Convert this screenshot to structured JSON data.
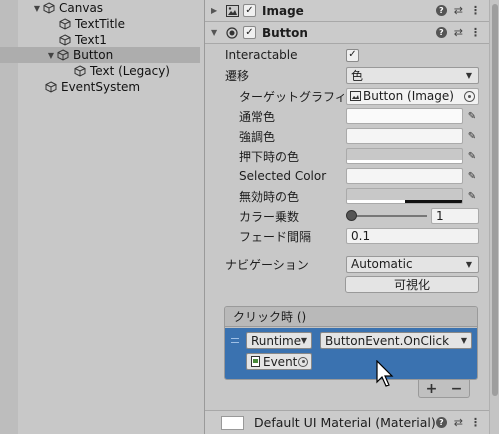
{
  "hierarchy": {
    "items": [
      {
        "label": "Canvas",
        "expanded": true
      },
      {
        "label": "TextTitle"
      },
      {
        "label": "Text1"
      },
      {
        "label": "Button",
        "expanded": true,
        "selected": true
      },
      {
        "label": "Text (Legacy)"
      },
      {
        "label": "EventSystem"
      }
    ]
  },
  "inspector": {
    "image_component": {
      "name": "Image",
      "enabled": true
    },
    "button_component": {
      "name": "Button",
      "enabled": true
    },
    "props": {
      "interactable_label": "Interactable",
      "interactable_value": true,
      "transition_label": "遷移",
      "transition_value": "色",
      "target_graphic_label": "ターゲットグラフィックス",
      "target_graphic_value": "Button (Image)",
      "normal_color_label": "通常色",
      "highlight_color_label": "強調色",
      "pressed_color_label": "押下時の色",
      "selected_color_label": "Selected Color",
      "disabled_color_label": "無効時の色",
      "color_multiplier_label": "カラー乗数",
      "color_multiplier_value": "1",
      "fade_duration_label": "フェード間隔",
      "fade_duration_value": "0.1",
      "navigation_label": "ナビゲーション",
      "navigation_value": "Automatic",
      "visualize_label": "可視化"
    },
    "onclick": {
      "header": "クリック時 ()",
      "runtime_value": "Runtime",
      "function_value": "ButtonEvent.OnClick",
      "object_value": "Event",
      "add": "+",
      "remove": "−"
    },
    "material": {
      "name": "Default UI Material (Material)"
    }
  },
  "colors": {
    "accent": "#3a72b0",
    "panel": "#c8c8c8"
  }
}
